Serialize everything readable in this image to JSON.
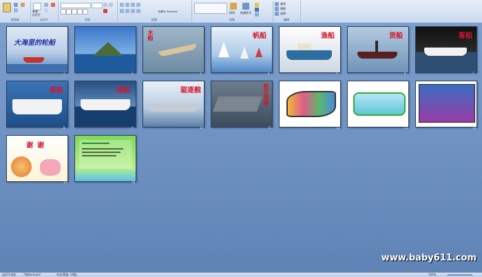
{
  "ribbon": {
    "groups": [
      {
        "label": "剪贴板"
      },
      {
        "label": "幻灯片"
      },
      {
        "label": "字体"
      },
      {
        "label": "段落"
      },
      {
        "label": "绘图"
      },
      {
        "label": "编辑"
      }
    ],
    "new_slide_label": "新建\n幻灯片",
    "smartart_label": "转换为 SmartArt",
    "arrange_label": "排列",
    "quick_styles_label": "快速样式",
    "find_label": "查找",
    "replace_label": "替换",
    "select_label": "选择"
  },
  "slides": [
    {
      "num": "1",
      "title": "大海里的轮船"
    },
    {
      "num": "2",
      "title": ""
    },
    {
      "num": "3",
      "title": "木船"
    },
    {
      "num": "4",
      "title": "帆船"
    },
    {
      "num": "5",
      "title": "渔船"
    },
    {
      "num": "6",
      "title": "货船"
    },
    {
      "num": "7",
      "title": "客船"
    },
    {
      "num": "8",
      "title": "客船"
    },
    {
      "num": "9",
      "title": "游船"
    },
    {
      "num": "10",
      "title": "驱逐舰"
    },
    {
      "num": "11",
      "title": "航空母舰"
    },
    {
      "num": "12",
      "title": ""
    },
    {
      "num": "13",
      "title": ""
    },
    {
      "num": "14",
      "title": ""
    },
    {
      "num": "15",
      "title": "谢谢"
    },
    {
      "num": "16",
      "title": ""
    }
  ],
  "watermark": "www.baby611.com",
  "status": {
    "view": "幻灯片浏览",
    "theme": "\"Watermark\"",
    "language": "中文(简体, 中国)",
    "zoom": "100%"
  },
  "colors": {
    "accent_title": "#d4162c",
    "background": "#6b8fbf"
  }
}
